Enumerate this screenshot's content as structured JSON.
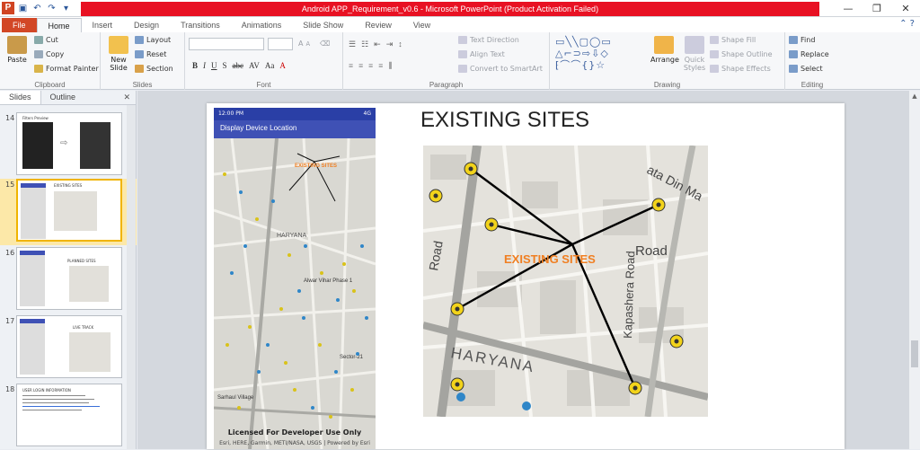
{
  "window": {
    "title": "Android APP_Requirement_v0.6  -  Microsoft PowerPoint (Product Activation Failed)"
  },
  "quick_access": {
    "save": "save-icon",
    "undo": "undo-icon",
    "redo": "redo-icon"
  },
  "tabs": [
    {
      "label": "File"
    },
    {
      "label": "Home"
    },
    {
      "label": "Insert"
    },
    {
      "label": "Design"
    },
    {
      "label": "Transitions"
    },
    {
      "label": "Animations"
    },
    {
      "label": "Slide Show"
    },
    {
      "label": "Review"
    },
    {
      "label": "View"
    }
  ],
  "ribbon": {
    "clipboard": {
      "label": "Clipboard",
      "paste": "Paste",
      "cut": "Cut",
      "copy": "Copy",
      "format_painter": "Format Painter"
    },
    "slides": {
      "label": "Slides",
      "new_slide": "New Slide",
      "layout": "Layout",
      "reset": "Reset",
      "section": "Section"
    },
    "font": {
      "label": "Font"
    },
    "paragraph": {
      "label": "Paragraph",
      "text_direction": "Text Direction",
      "align_text": "Align Text",
      "convert_smartart": "Convert to SmartArt"
    },
    "drawing": {
      "label": "Drawing",
      "arrange": "Arrange",
      "quick_styles": "Quick Styles",
      "shape_fill": "Shape Fill",
      "shape_outline": "Shape Outline",
      "shape_effects": "Shape Effects"
    },
    "editing": {
      "label": "Editing",
      "find": "Find",
      "replace": "Replace",
      "select": "Select"
    }
  },
  "panel": {
    "tabs": [
      "Slides",
      "Outline"
    ],
    "slides": [
      {
        "num": "14",
        "caption": "Filters  Preview"
      },
      {
        "num": "15",
        "caption": "EXISTING SITES",
        "selected": true
      },
      {
        "num": "16",
        "caption": "PLANNED SITES"
      },
      {
        "num": "17",
        "caption": "LIVE TRACK"
      },
      {
        "num": "18",
        "caption": "USER LOGIN INFORMATION"
      }
    ]
  },
  "slide": {
    "title": "EXISTING SITES",
    "phone": {
      "time": "12:00 PM",
      "signal": "4G",
      "app_title": "Display Device Location",
      "map_label": "EXISTING SITES",
      "area_haryana": "HARYANA",
      "area_alwar": "Alwar Vihar Phase 1",
      "area_sector": "Sector-21",
      "area_sarhaul": "Sarhaul Village",
      "license": "Licensed For Developer Use Only",
      "attribution": "Esri, HERE, Garmin, METI/NASA, USGS  |  Powered by Esri"
    },
    "map": {
      "label": "EXISTING SITES",
      "road_1": "Road",
      "road_2": "Road",
      "road_3": "Kapashera Road",
      "road_4": "ata Din Ma",
      "area": "HARYANA"
    }
  },
  "colors": {
    "file_tab": "#d24726",
    "title_error": "#e81123",
    "appbar": "#3f51b5",
    "label_orange": "#f07f22"
  }
}
